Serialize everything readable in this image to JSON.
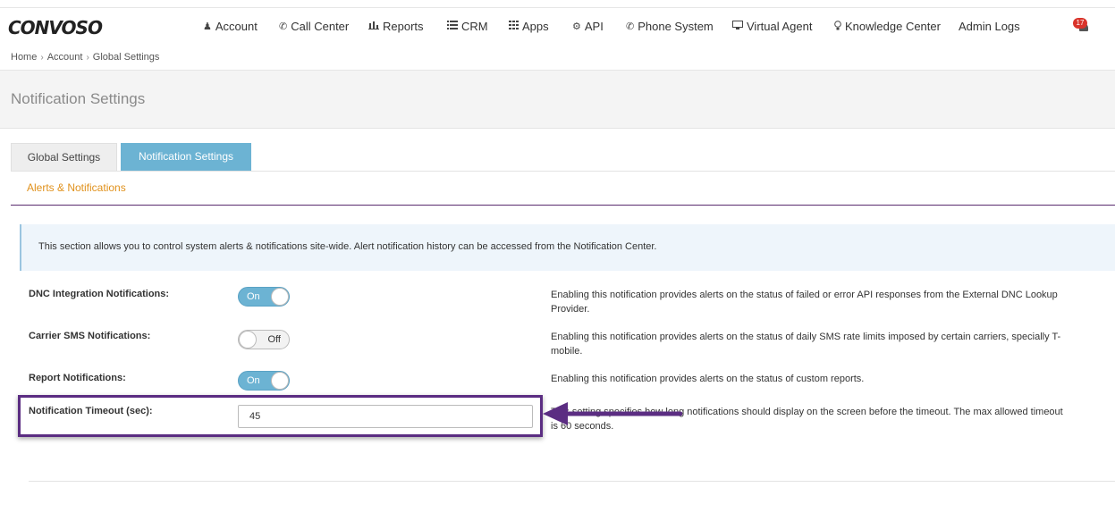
{
  "brand": {
    "logo_text": "CONVOSO"
  },
  "nav": {
    "items": [
      {
        "label": "Account",
        "icon": "user-icon"
      },
      {
        "label": "Call Center",
        "icon": "phone-icon"
      },
      {
        "label": "Reports",
        "icon": "bar-chart-icon"
      },
      {
        "label": "CRM",
        "icon": "list-icon"
      },
      {
        "label": "Apps",
        "icon": "grid-icon"
      },
      {
        "label": "API",
        "icon": "cog-icon"
      },
      {
        "label": "Phone System",
        "icon": "phone-icon"
      },
      {
        "label": "Virtual Agent",
        "icon": "monitor-icon"
      },
      {
        "label": "Knowledge Center",
        "icon": "lightbulb-icon"
      },
      {
        "label": "Admin Logs",
        "icon": ""
      }
    ],
    "notification_count": "17"
  },
  "breadcrumb": {
    "items": [
      "Home",
      "Account",
      "Global Settings"
    ],
    "separator": "›"
  },
  "page": {
    "title": "Notification Settings"
  },
  "tabs": [
    {
      "label": "Global Settings",
      "active": false
    },
    {
      "label": "Notification Settings",
      "active": true
    }
  ],
  "section": {
    "title": "Alerts & Notifications"
  },
  "info": {
    "text": "This section allows you to control system alerts & notifications site-wide. Alert notification history can be accessed from the Notification Center."
  },
  "settings": [
    {
      "label": "DNC Integration Notifications:",
      "state": "On",
      "description": "Enabling this notification provides alerts on the status of failed or error API responses from the External DNC Lookup Provider."
    },
    {
      "label": "Carrier SMS Notifications:",
      "state": "Off",
      "description": "Enabling this notification provides alerts on the status of daily SMS rate limits imposed by certain carriers, specially T-mobile."
    },
    {
      "label": "Report Notifications:",
      "state": "On",
      "description": "Enabling this notification provides alerts on the status of custom reports."
    }
  ],
  "timeout": {
    "label": "Notification Timeout (sec):",
    "value": "45",
    "description": "This setting specifies how long notifications should display on the screen before the timeout. The max allowed timeout is 60 seconds."
  },
  "colors": {
    "accent_blue": "#6cb3d3",
    "section_orange": "#e0911c",
    "highlight_purple": "#5b2d82",
    "badge_red": "#d9342b"
  }
}
